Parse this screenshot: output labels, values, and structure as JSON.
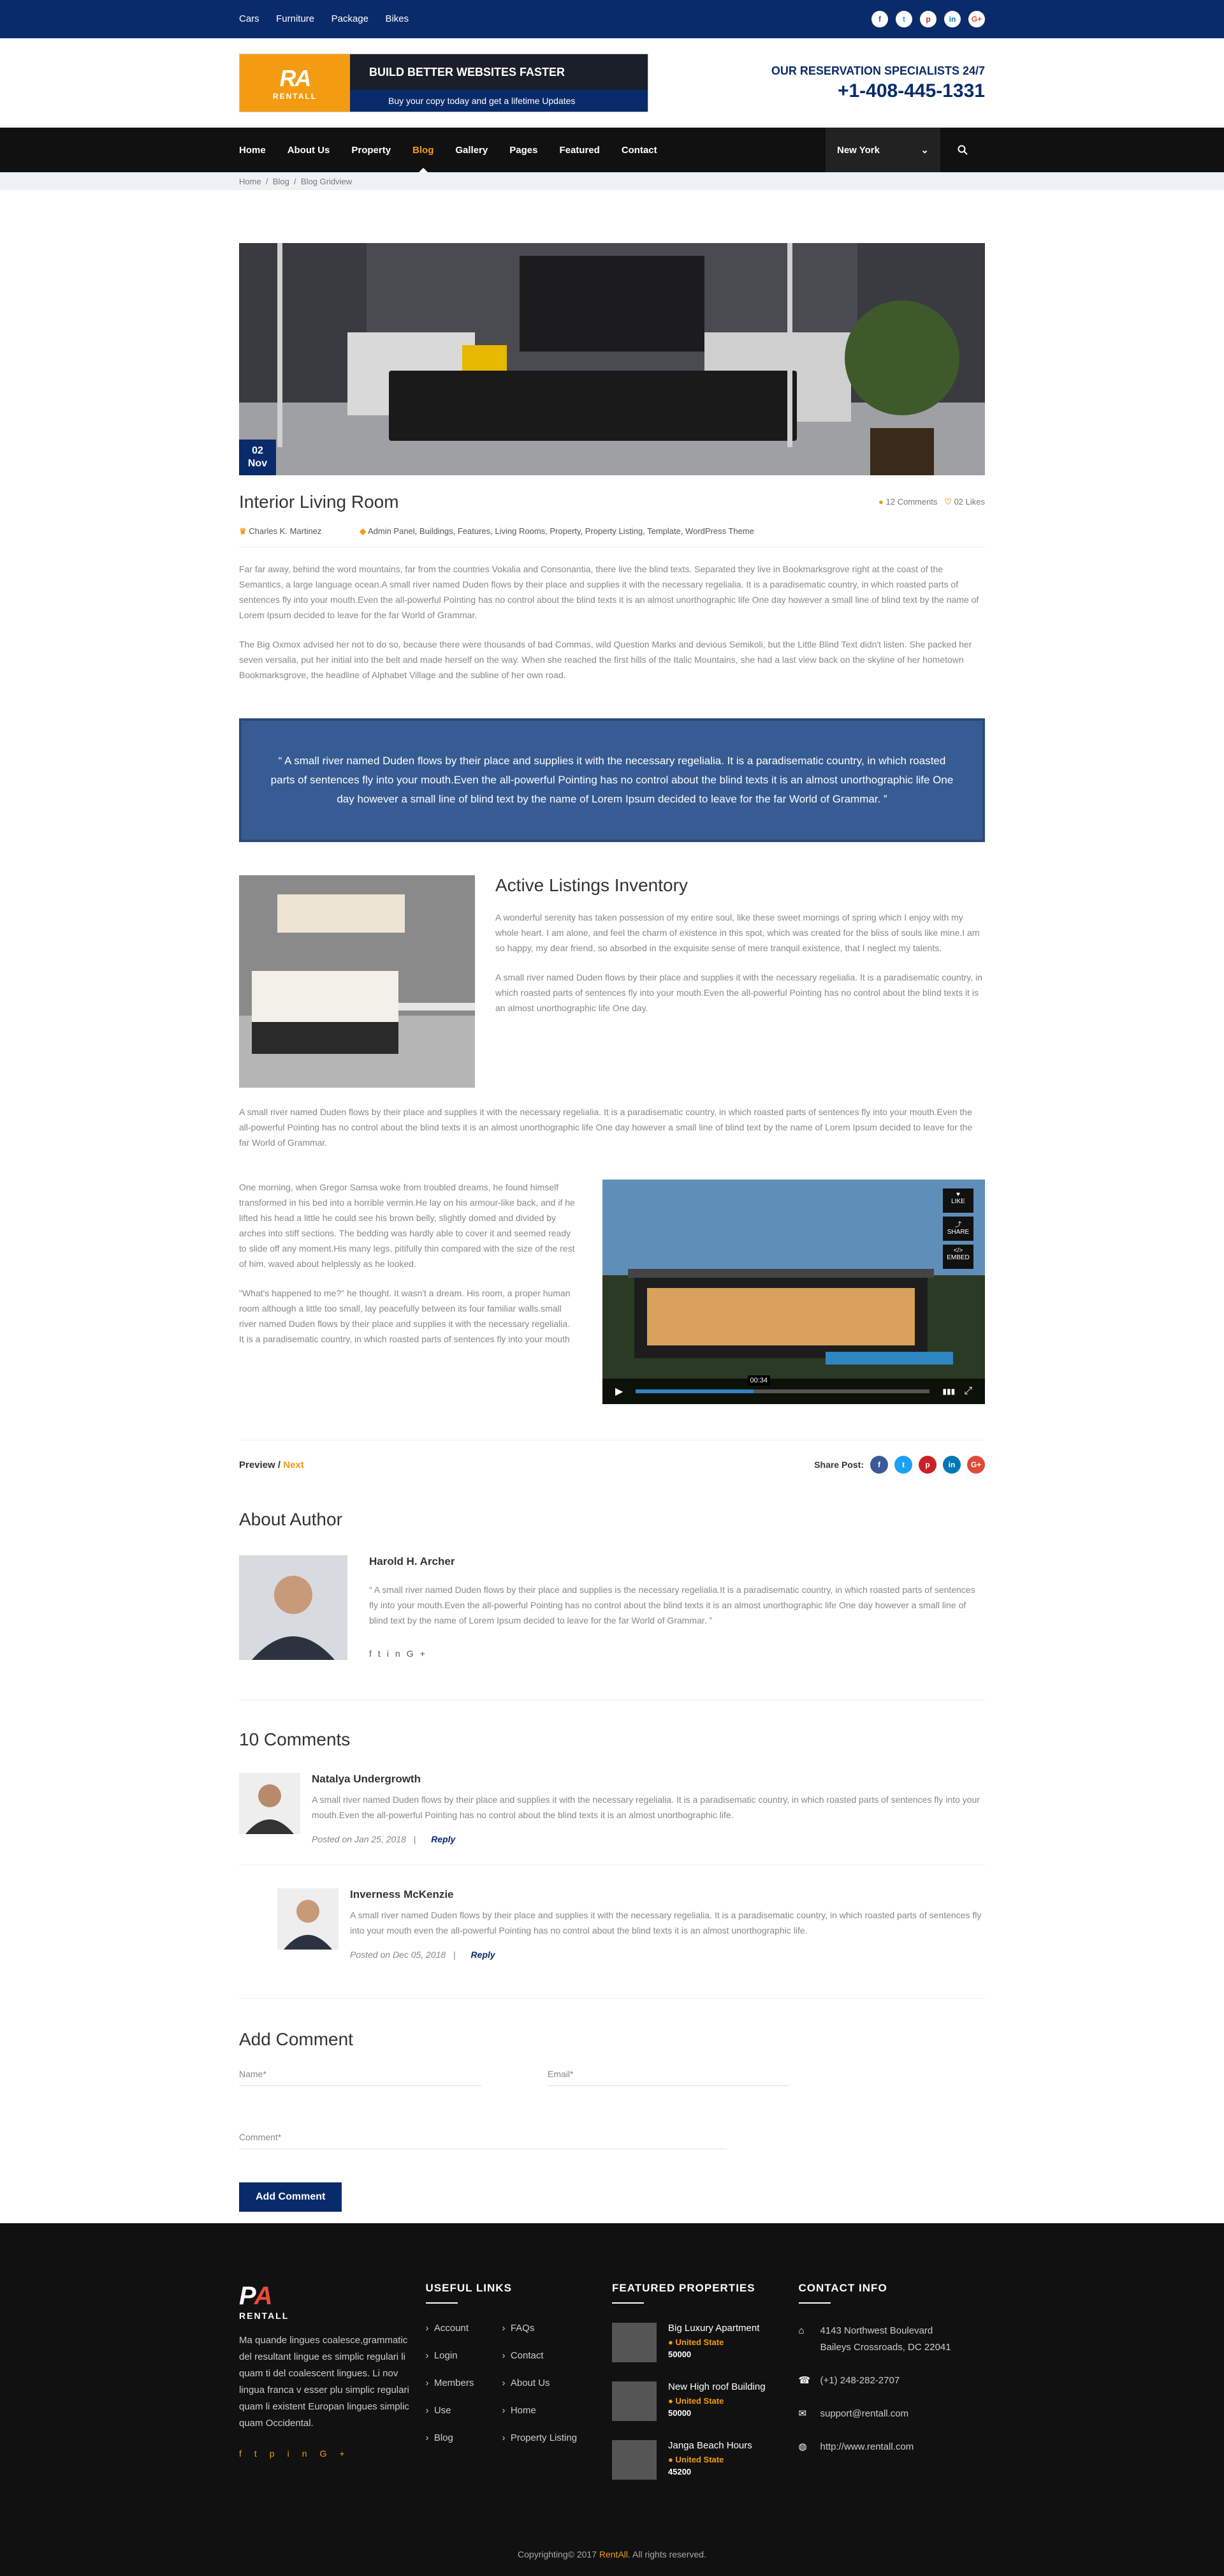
{
  "topbar": {
    "links": [
      "Cars",
      "Furniture",
      "Package",
      "Bikes"
    ],
    "social_icons": [
      "facebook-icon",
      "twitter-icon",
      "pinterest-icon",
      "linkedin-icon",
      "google-plus-icon"
    ]
  },
  "header": {
    "logo_text": "RENTALL",
    "banner_title": "BUILD BETTER WEBSITES FASTER",
    "banner_sub": "Buy your copy today and get a lifetime Updates",
    "resv_label": "OUR RESERVATION SPECIALISTS 24/7",
    "resv_phone": "+1-408-445-1331"
  },
  "nav": {
    "items": [
      "Home",
      "About Us",
      "Property",
      "Blog",
      "Gallery",
      "Pages",
      "Featured",
      "Contact"
    ],
    "active": "Blog",
    "city": "New York"
  },
  "breadcrumb": {
    "items": [
      "Home",
      "Blog",
      "Blog Gridview"
    ],
    "sep": "/"
  },
  "post": {
    "day": "02",
    "month": "Nov",
    "title": "Interior Living Room",
    "comments": "12 Comments",
    "likes": "02 Likes",
    "author": "Charles K. Martinez",
    "tags": "Admin Panel, Buildings, Features, Living Rooms, Property, Property Listing, Template, WordPress Theme",
    "p1": "Far far away, behind the word mountains, far from the countries Vokalia and Consonantia, there live the blind texts. Separated they live in Bookmarksgrove right at the coast of the Semantics, a large language ocean.A small river named Duden flows by their place and supplies it with the necessary regelialia. It is a paradisematic country, in which roasted parts of sentences fly into your mouth.Even the all-powerful Pointing has no control about the blind texts it is an almost unorthographic life One day however a small line of blind text by the name of Lorem Ipsum decided to leave for the far World of Grammar.",
    "p2": "The Big Oxmox advised her not to do so, because there were thousands of bad Commas, wild Question Marks and devious Semikoli, but the Little Blind Text didn't listen. She packed her seven versalia, put her initial into the belt and made herself on the way. When she reached the first hills of the Italic Mountains, she had a last view back on the skyline of her hometown Bookmarksgrove, the headline of Alphabet Village and the subline of her own road.",
    "quote": "A small river named Duden flows by their place and supplies it with the necessary regelialia. It is a paradisematic country, in which roasted parts of sentences fly into your mouth.Even the all-powerful Pointing has no control about the blind texts it is an almost unorthographic life One day however a small line of blind text by the name of Lorem Ipsum decided to leave for the far World of Grammar.",
    "listing_title": "Active Listings Inventory",
    "listing_p1": "A wonderful serenity has taken possession of my entire soul, like these sweet mornings of spring which I enjoy with my whole heart. I am alone, and feel the charm of existence in this spot, which was created for the bliss of souls like mine.I am so happy, my dear friend, so absorbed in the exquisite sense of mere tranquil existence, that I neglect my talents.",
    "listing_p2": "A small river named Duden flows by their place and supplies it with the necessary regelialia. It is a paradisematic country, in which roasted parts of sentences fly into your mouth.Even the all-powerful Pointing has no control about the blind texts it is an almost unorthographic life One day.",
    "p3": "A small river named Duden flows by their place and supplies it with the necessary regelialia. It is a paradisematic country, in which roasted parts of sentences fly into your mouth.Even the all-powerful Pointing has no control about the blind texts it is an almost unorthographic life One day however a small line of blind text by the name of Lorem Ipsum decided to leave for the far World of Grammar.",
    "p4": "One morning, when Gregor Samsa woke from troubled dreams, he found himself transformed in his bed into a horrible vermin.He lay on his armour-like back, and if he lifted his head a little he could see his brown belly, slightly domed and divided by arches into stiff sections. The bedding was hardly able to cover it and seemed ready to slide off any moment.His many legs, pitifully thin compared with the size of the rest of him, waved about helplessly as he looked.",
    "p5": "\"What's happened to me?\" he thought. It wasn't a dream. His room, a proper human room although a little too small, lay peacefully between its four familiar walls.small river named Duden flows by their place and supplies it with the necessary regelialia. It is a paradisematic country, in which roasted parts of sentences fly into your mouth",
    "video_time": "00:34",
    "video_side": [
      "LIKE",
      "SHARE",
      "EMBED"
    ]
  },
  "share": {
    "prev": "Preview",
    "sep": "/",
    "next": "Next",
    "label": "Share Post:"
  },
  "about": {
    "heading": "About Author",
    "name": "Harold H. Archer",
    "text": "A small river named Duden flows by their place and supplies is the necessary regelialia.It is a paradisematic country, in which roasted parts of sentences fly into your mouth.Even the all-powerful Pointing has no control about the blind texts it is an almost unorthographic life One day however a small line of blind text by the name of Lorem Ipsum decided to leave for the far World of Grammar."
  },
  "comments": {
    "heading": "10 Comments",
    "items": [
      {
        "name": "Natalya Undergrowth",
        "text": "A small river named Duden flows by their place and supplies it with the necessary regelialia. It is a paradisematic country, in which roasted parts of sentences fly into your mouth.Even the all-powerful Pointing has no control about the blind texts it is an almost unorthographic life.",
        "date": "Posted on Jan 25, 2018",
        "reply": "Reply"
      },
      {
        "name": "Inverness McKenzie",
        "text": "A small river named Duden flows by their place and supplies it with the necessary regelialia. It is a paradisematic country, in which roasted parts of sentences fly into your mouth even the all-powerful Pointing has no control about the blind texts it is an almost unorthographic life.",
        "date": "Posted on Dec 05, 2018",
        "reply": "Reply"
      }
    ]
  },
  "form": {
    "heading": "Add Comment",
    "name_ph": "Name*",
    "email_ph": "Email*",
    "comment_ph": "Comment*",
    "submit": "Add Comment"
  },
  "footer": {
    "logo": "RENTALL",
    "about": "Ma quande lingues coalesce,grammatic del resultant lingue es simplic regulari li quam ti del coalescent lingues. Li nov lingua franca v esser plu simplic regulari quam li existent Europan lingues simplic quam Occidental.",
    "links_heading": "USEFUL LINKS",
    "links_a": [
      "Account",
      "Login",
      "Members",
      "Use",
      "Blog"
    ],
    "links_b": [
      "FAQs",
      "Contact",
      "About Us",
      "Home",
      "Property Listing"
    ],
    "props_heading": "FEATURED PROPERTIES",
    "props": [
      {
        "name": "Big Luxury Apartment",
        "loc": "United State",
        "price": "50000"
      },
      {
        "name": "New High roof Building",
        "loc": "United State",
        "price": "50000"
      },
      {
        "name": "Janga Beach Hours",
        "loc": "United State",
        "price": "45200"
      }
    ],
    "contact_heading": "CONTACT INFO",
    "address": "4143 Northwest Boulevard Baileys Crossroads, DC 22041",
    "phone": "(+1) 248-282-2707",
    "email": "support@rentall.com",
    "web": "http://www.rentall.com",
    "copy_a": "Copyrighting© 2017",
    "copy_brand": "RentAll",
    "copy_b": ". All rights reserved."
  },
  "colors": {
    "navy": "#0a2b6b",
    "orange": "#f39c12",
    "quote_bg": "#375c93",
    "footer_bg": "#111111"
  }
}
